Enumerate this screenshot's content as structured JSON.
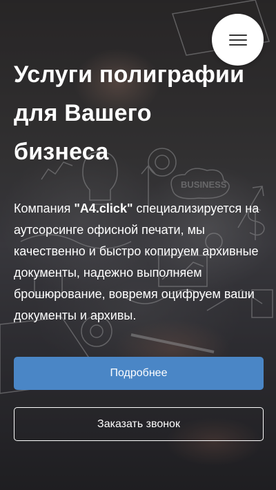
{
  "hero": {
    "title": "Услуги полиграфии для Вашего бизнеса",
    "text_prefix": "Компания ",
    "company_name": "\"A4.click\"",
    "text_suffix": " специализируется на аутсорсинге офисной печати, мы качественно и быстро копируем архивные документы, надежно выполняем брошюрование, вовремя оцифруем ваши документы и архивы.",
    "primary_button": "Подробнее",
    "secondary_button": "Заказать звонок"
  },
  "header": {
    "menu_icon": "hamburger-menu-icon"
  },
  "background": {
    "sketch_word": "BUSINESS"
  },
  "colors": {
    "primary_button": "#4a86c6",
    "menu_button_bg": "#ffffff",
    "text": "#ffffff"
  }
}
